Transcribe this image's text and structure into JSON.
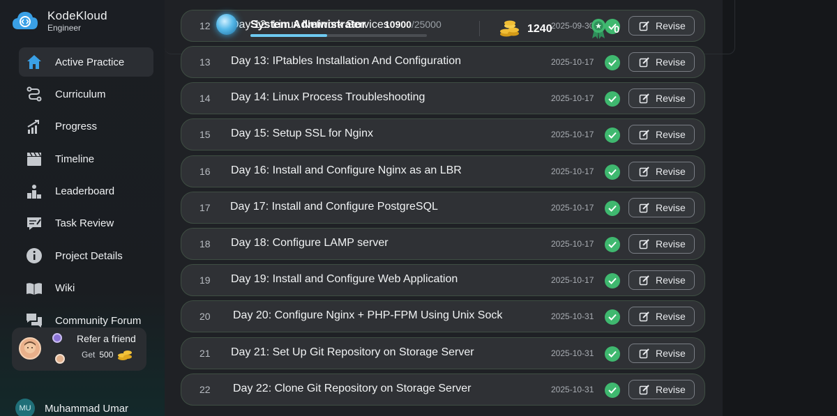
{
  "brand": {
    "name": "KodeKloud",
    "sub": "Engineer"
  },
  "sidebar": {
    "items": [
      {
        "label": "Active Practice",
        "icon": "home-icon"
      },
      {
        "label": "Curriculum",
        "icon": "route-icon"
      },
      {
        "label": "Progress",
        "icon": "chart-up-icon"
      },
      {
        "label": "Timeline",
        "icon": "clapper-icon"
      },
      {
        "label": "Leaderboard",
        "icon": "podium-icon"
      },
      {
        "label": "Task Review",
        "icon": "review-icon"
      },
      {
        "label": "Project Details",
        "icon": "info-icon"
      },
      {
        "label": "Wiki",
        "icon": "book-icon"
      },
      {
        "label": "Community Forum",
        "icon": "chat-icon"
      }
    ],
    "refer": {
      "title": "Refer a friend",
      "get_label": "Get",
      "amount": "500"
    },
    "user": {
      "initials": "MU",
      "name": "Muhammad Umar"
    }
  },
  "header": {
    "role": "System Administrator",
    "xp_current": "10900",
    "xp_total": "/25000",
    "xp_progress": 0.436,
    "coins": "1240",
    "badges": "0"
  },
  "tasks": {
    "button_label": "Revise",
    "rows": [
      {
        "num": "12",
        "title": "Day 12: Linux Network Services",
        "date": "2025-09-30"
      },
      {
        "num": "13",
        "title": "Day 13: IPtables Installation And Configuration",
        "date": "2025-10-17"
      },
      {
        "num": "14",
        "title": "Day 14: Linux Process Troubleshooting",
        "date": "2025-10-17"
      },
      {
        "num": "15",
        "title": "Day 15: Setup SSL for Nginx",
        "date": "2025-10-17"
      },
      {
        "num": "16",
        "title": "Day 16: Install and Configure Nginx as an LBR",
        "date": "2025-10-17"
      },
      {
        "num": "17",
        "title": "Day 17: Install and Configure PostgreSQL",
        "date": "2025-10-17"
      },
      {
        "num": "18",
        "title": "Day 18: Configure LAMP server",
        "date": "2025-10-17"
      },
      {
        "num": "19",
        "title": "Day 19: Install and Configure Web Application",
        "date": "2025-10-17"
      },
      {
        "num": "20",
        "title": "Day 20: Configure Nginx + PHP-FPM Using Unix Sock",
        "date": "2025-10-31"
      },
      {
        "num": "21",
        "title": "Day 21: Set Up Git Repository on Storage Server",
        "date": "2025-10-31"
      },
      {
        "num": "22",
        "title": "Day 22: Clone Git Repository on Storage Server",
        "date": "2025-10-31"
      }
    ]
  },
  "colors": {
    "accent": "#3fb86f",
    "progress": "#6ec9f0",
    "active_nav": "#2b2e33"
  }
}
